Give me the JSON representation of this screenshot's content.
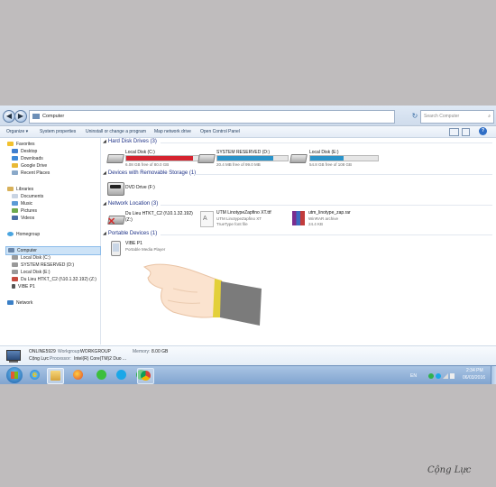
{
  "address": {
    "location": "Computer",
    "search_placeholder": "Search Computer"
  },
  "toolbar": {
    "items": [
      "Organize ▾",
      "System properties",
      "Uninstall or change a program",
      "Map network drive",
      "Open Control Panel"
    ]
  },
  "nav": {
    "favorites": {
      "label": "Favorites",
      "items": [
        "Desktop",
        "Downloads",
        "Google Drive",
        "Recent Places"
      ]
    },
    "libraries": {
      "label": "Libraries",
      "items": [
        "Documents",
        "Music",
        "Pictures",
        "Videos"
      ]
    },
    "homegroup": "Homegroup",
    "computer": {
      "label": "Computer",
      "items": [
        "Local Disk (C:)",
        "SYSTEM RESERVED (D:)",
        "Local Disk (E:)",
        "Du Lieu HTKT_C2 (\\\\10.1.32.192) (Z:)",
        "VIBE P1"
      ]
    },
    "network": "Network"
  },
  "groups": {
    "hard_disk": "Hard Disk Drives (3)",
    "removable": "Devices with Removable Storage (1)",
    "network_location": "Network Location (3)",
    "portable": "Portable Devices (1)"
  },
  "drives": [
    {
      "name": "Local Disk (C:)",
      "free": "6.08 GB free of 80.0 GB",
      "used_fraction": 0.92,
      "bar_color": "#d5232f"
    },
    {
      "name": "SYSTEM RESERVED (D:)",
      "free": "20.4 MB free of 99.0 MB",
      "used_fraction": 0.79,
      "bar_color": "#2a93c9"
    },
    {
      "name": "Local Disk (E:)",
      "free": "54.8 GB free of 108 GB",
      "used_fraction": 0.49,
      "bar_color": "#2a93c9"
    }
  ],
  "removable": {
    "name": "DVD Drive (F:)"
  },
  "network_items": [
    {
      "name": "Du Lieu HTKT_C2 (\\\\10.1.32.192)",
      "sub": "(Z:)"
    },
    {
      "name": "UTM LinotypeZapfino XT.ttf",
      "sub": "UTM LinotypeZapfino XT",
      "sub2": "TrueType font file"
    },
    {
      "name": "utm_linotype_zap.rar",
      "sub": "WinRAR archive",
      "sub2": "24.4 KB"
    }
  ],
  "portable": {
    "name": "VIBE P1",
    "sub": "Portable Media Player"
  },
  "details": {
    "computer_name": "ONLINE5929",
    "workgroup_label": "Workgroup:",
    "workgroup": "WORKGROUP",
    "memory_label": "Memory:",
    "memory": "8.00 GB",
    "user": "Cộng Lực",
    "processor_label": "Processor:",
    "processor": "Intel(R) Core(TM)2 Duo ..."
  },
  "taskbar": {
    "apps": [
      "start-orb",
      "internet-explorer",
      "windows-explorer",
      "firefox",
      "line",
      "skype",
      "whatsapp",
      "chrome"
    ],
    "language": "EN",
    "time": "2:34 PM",
    "date": "06/03/2016"
  },
  "watermark": "Cộng Lực",
  "colors": {
    "accent": "#1e3287",
    "taskbar": "#8eaed6",
    "sleeve": "#7b7b7b",
    "cuff": "#e3d03a"
  }
}
